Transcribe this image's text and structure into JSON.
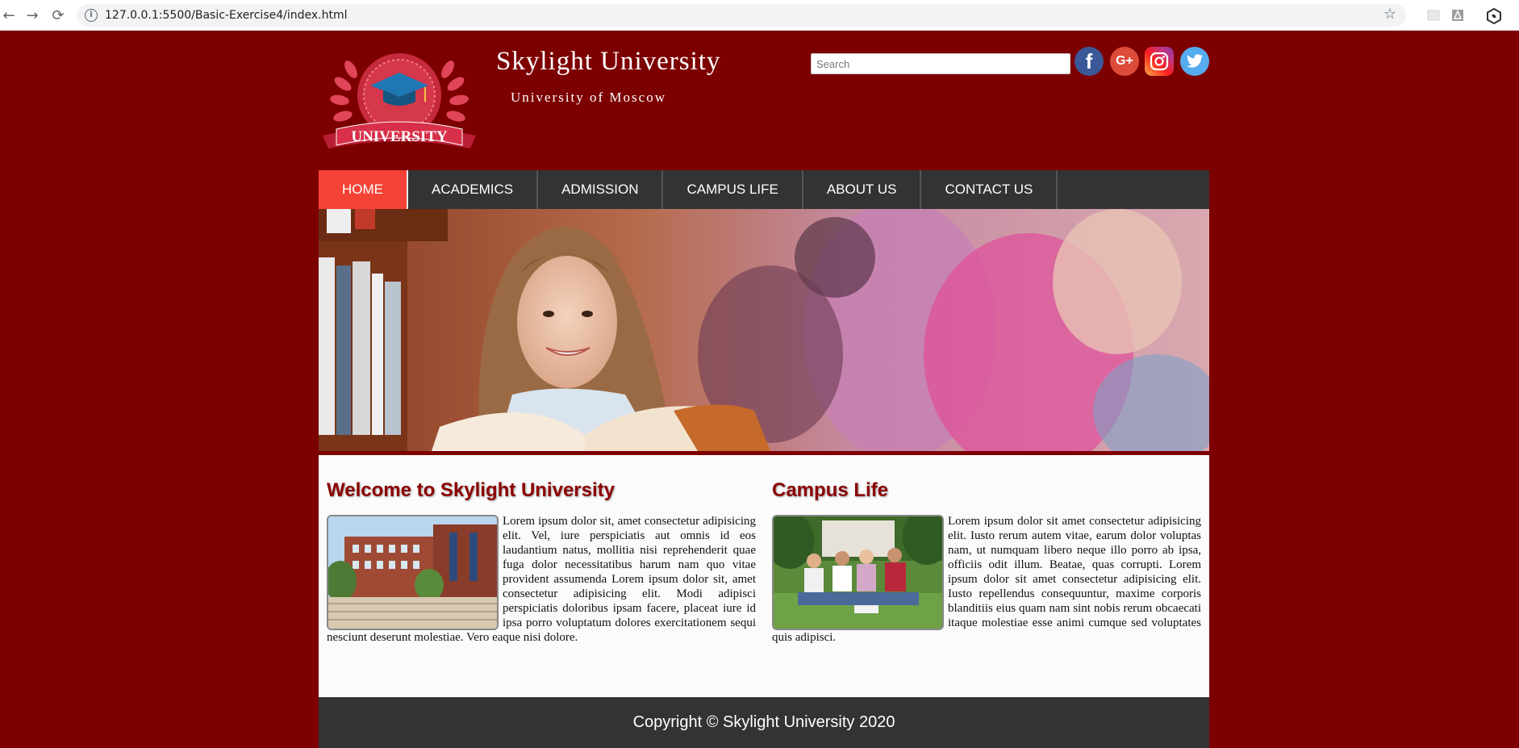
{
  "browser": {
    "url": "127.0.0.1:5500/Basic-Exercise4/index.html",
    "back_icon": "←",
    "forward_icon": "→",
    "reload_icon": "⟳",
    "info_icon": "i",
    "star_icon": "☆"
  },
  "header": {
    "title": "Skylight University",
    "subtitle": "University of Moscow",
    "logo_text": "UNIVERSITY",
    "search_placeholder": "Search",
    "social": {
      "facebook": "f",
      "google_plus": "G+"
    }
  },
  "nav": {
    "items": [
      "HOME",
      "ACADEMICS",
      "ADMISSION",
      "CAMPUS LIFE",
      "ABOUT US",
      "CONTACT US"
    ],
    "active": "HOME"
  },
  "sections": {
    "welcome": {
      "heading": "Welcome to Skylight University",
      "text": "Lorem ipsum dolor sit, amet consectetur adipisicing elit. Vel, iure perspiciatis aut omnis id eos laudantium natus, mollitia nisi reprehenderit quae fuga dolor necessitatibus harum nam quo vitae provident assumenda Lorem ipsum dolor sit, amet consectetur adipisicing elit. Modi adipisci perspiciatis doloribus ipsam facere, placeat iure id ipsa porro voluptatum dolores exercitationem sequi nesciunt deserunt molestiae. Vero eaque nisi dolore."
    },
    "campus": {
      "heading": "Campus Life",
      "text": "Lorem ipsum dolor sit amet consectetur adipisicing elit. Iusto rerum autem vitae, earum dolor voluptas nam, ut numquam libero neque illo porro ab ipsa, officiis odit illum. Beatae, quas corrupti. Lorem ipsum dolor sit amet consectetur adipisicing elit. Iusto repellendus consequuntur, maxime corporis blanditiis eius quam nam sint nobis rerum obcaecati itaque molestiae esse animi cumque sed voluptates quis adipisci."
    }
  },
  "footer": {
    "copyright": "Copyright © Skylight University 2020"
  },
  "colors": {
    "background": "#7d0000",
    "nav_bg": "#333333",
    "nav_active": "#f44336",
    "heading": "#8b0000"
  }
}
